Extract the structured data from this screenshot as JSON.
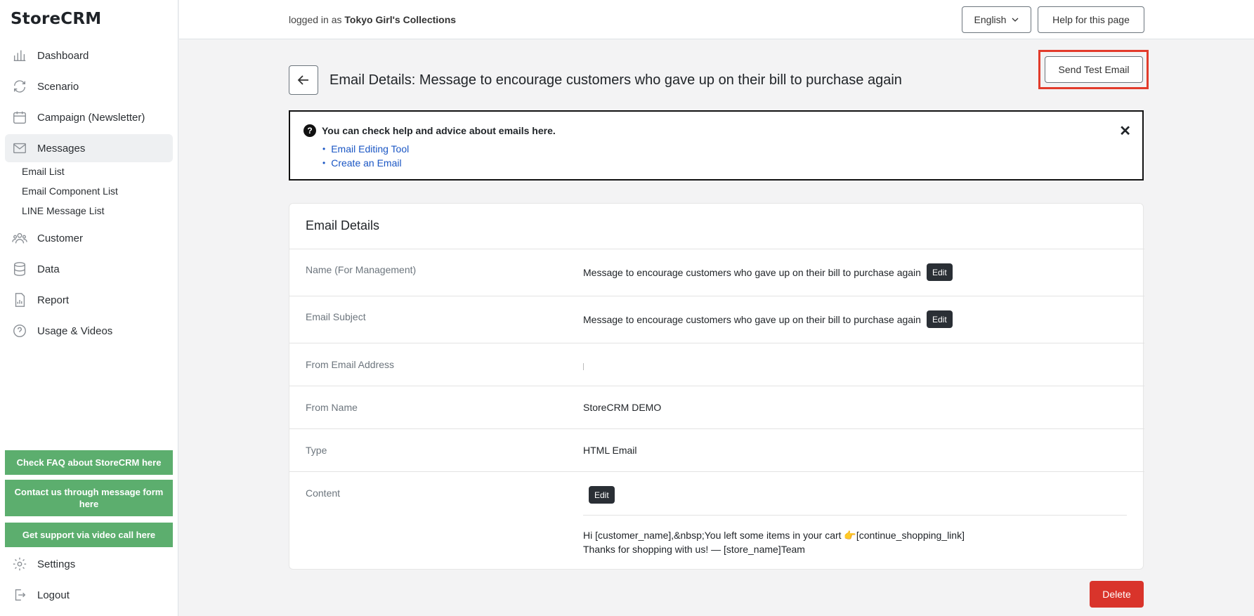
{
  "app": {
    "logo": "StoreCRM"
  },
  "sidebar": {
    "items": [
      {
        "label": "Dashboard",
        "icon": "bar-chart-icon"
      },
      {
        "label": "Scenario",
        "icon": "refresh-icon"
      },
      {
        "label": "Campaign (Newsletter)",
        "icon": "calendar-icon"
      },
      {
        "label": "Messages",
        "icon": "envelope-icon"
      },
      {
        "label": "Customer",
        "icon": "users-icon"
      },
      {
        "label": "Data",
        "icon": "database-icon"
      },
      {
        "label": "Report",
        "icon": "report-icon"
      },
      {
        "label": "Usage & Videos",
        "icon": "help-circle-icon"
      }
    ],
    "sub_items": [
      "Email List",
      "Email Component List",
      "LINE Message List"
    ],
    "support": [
      "Check FAQ about StoreCRM here",
      "Contact us through message form here",
      "Get support via video call here"
    ],
    "settings": "Settings",
    "logout": "Logout"
  },
  "header": {
    "logged_prefix": "logged in as",
    "store_name": "Tokyo Girl's Collections",
    "language": "English",
    "help": "Help for this page"
  },
  "page": {
    "title": "Email Details: Message to encourage customers who gave up on their bill to purchase again",
    "send_test": "Send Test Email",
    "delete": "Delete"
  },
  "info": {
    "title": "You can check help and advice about emails here.",
    "links": [
      "Email Editing Tool",
      "Create an Email"
    ]
  },
  "details": {
    "heading": "Email Details",
    "edit_label": "Edit",
    "rows": [
      {
        "label": "Name (For Management)",
        "value": "Message to encourage customers who gave up on their bill to purchase again"
      },
      {
        "label": "Email Subject",
        "value": "Message to encourage customers who gave up on their bill to purchase again"
      },
      {
        "label": "From Email Address",
        "value": ""
      },
      {
        "label": "From Name",
        "value": "StoreCRM DEMO"
      },
      {
        "label": "Type",
        "value": "HTML Email"
      },
      {
        "label": "Content",
        "value": ""
      }
    ],
    "content_line1": "Hi [customer_name],&nbsp;You left some items in your cart 👉[continue_shopping_link]",
    "content_line2": "Thanks for shopping with us! — [store_name]Team"
  },
  "colors": {
    "accent_red": "#d9342b",
    "support_green": "#5cae6e",
    "highlight": "#e23b2b",
    "edit_dark": "#2a2f35"
  }
}
